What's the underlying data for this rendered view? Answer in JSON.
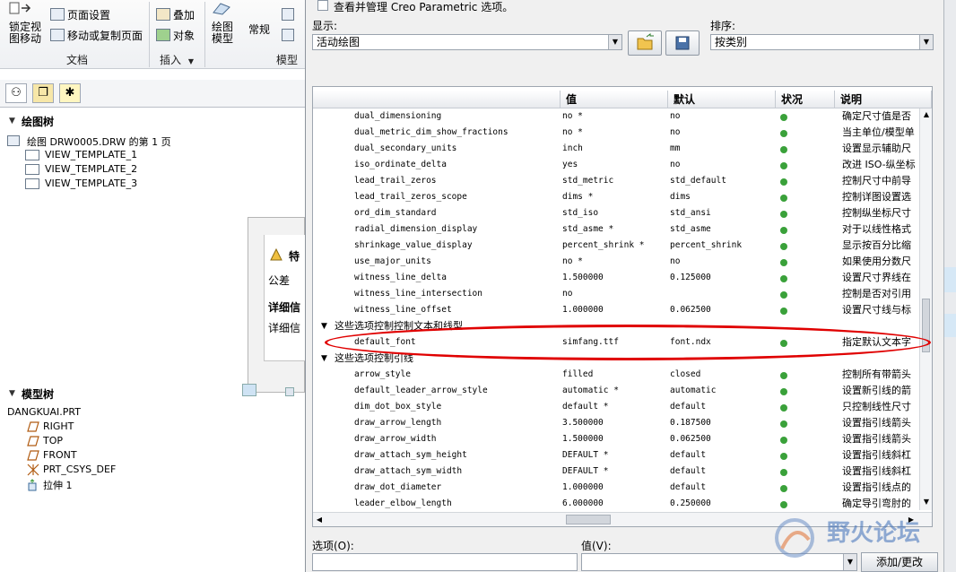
{
  "ribbon": {
    "lock_view_line1": "锁定视",
    "lock_view_line2": "图移动",
    "page_setup": "页面设置",
    "move_copy_page": "移动或复制页面",
    "overlay": "叠加",
    "object": "对象",
    "drawing_model_line1": "绘图",
    "drawing_model_line2": "模型",
    "general": "常规",
    "group_document": "文档",
    "group_insert": "插入",
    "group_insert_arrow": "▼",
    "group_model": "模型"
  },
  "left_panel": {
    "drawing_tree_title": "绘图树",
    "drawing_root": "绘图 DRW0005.DRW 的第 1 页",
    "drawing_items": [
      "VIEW_TEMPLATE_1",
      "VIEW_TEMPLATE_2",
      "VIEW_TEMPLATE_3"
    ],
    "model_tree_title": "模型树",
    "model_root": "DANGKUAI.PRT",
    "model_items": [
      "RIGHT",
      "TOP",
      "FRONT",
      "PRT_CSYS_DEF",
      "拉伸 1"
    ]
  },
  "bg_dialog": {
    "title_frag": "特",
    "tolerance": "公差",
    "detail_info": "详细信",
    "detail_info2": "详细信"
  },
  "dialog": {
    "title": "查看并管理 Creo Parametric 选项。",
    "show_label": "显示:",
    "show_value": "活动绘图",
    "sort_label": "排序:",
    "sort_value": "按类别",
    "columns": {
      "value": "值",
      "default": "默认",
      "status": "状况",
      "description": "说明"
    },
    "rows1": [
      {
        "name": "dual_dimensioning",
        "value": "no *",
        "default": "no",
        "desc": "确定尺寸值是否"
      },
      {
        "name": "dual_metric_dim_show_fractions",
        "value": "no *",
        "default": "no",
        "desc": "当主单位/模型单"
      },
      {
        "name": "dual_secondary_units",
        "value": "inch",
        "default": "mm",
        "desc": "设置显示辅助尺"
      },
      {
        "name": "iso_ordinate_delta",
        "value": "yes",
        "default": "no",
        "desc": "改进 ISO-纵坐标"
      },
      {
        "name": "lead_trail_zeros",
        "value": "std_metric",
        "default": "std_default",
        "desc": "控制尺寸中前导"
      },
      {
        "name": "lead_trail_zeros_scope",
        "value": "dims *",
        "default": "dims",
        "desc": "控制详图设置选"
      },
      {
        "name": "ord_dim_standard",
        "value": "std_iso",
        "default": "std_ansi",
        "desc": "控制纵坐标尺寸"
      },
      {
        "name": "radial_dimension_display",
        "value": "std_asme *",
        "default": "std_asme",
        "desc": "对于以线性格式"
      },
      {
        "name": "shrinkage_value_display",
        "value": "percent_shrink *",
        "default": "percent_shrink",
        "desc": "显示按百分比缩"
      },
      {
        "name": "use_major_units",
        "value": "no *",
        "default": "no",
        "desc": "如果使用分数尺"
      },
      {
        "name": "witness_line_delta",
        "value": "1.500000",
        "default": "0.125000",
        "desc": "设置尺寸界线在"
      },
      {
        "name": "witness_line_intersection",
        "value": "no",
        "default": "",
        "desc": "控制是否对引用"
      },
      {
        "name": "witness_line_offset",
        "value": "1.000000",
        "default": "0.062500",
        "desc": "设置尺寸线与标"
      }
    ],
    "group2": "这些选项控制控制文本和线型",
    "rows2": [
      {
        "name": "default_font",
        "value": "simfang.ttf",
        "default": "font.ndx",
        "desc": "指定默认文本字"
      }
    ],
    "group3": "这些选项控制引线",
    "rows3": [
      {
        "name": "arrow_style",
        "value": "filled",
        "default": "closed",
        "desc": "控制所有带箭头"
      },
      {
        "name": "default_leader_arrow_style",
        "value": "automatic *",
        "default": "automatic",
        "desc": "设置新引线的箭"
      },
      {
        "name": "dim_dot_box_style",
        "value": "default *",
        "default": "default",
        "desc": "只控制线性尺寸"
      },
      {
        "name": "draw_arrow_length",
        "value": "3.500000",
        "default": "0.187500",
        "desc": "设置指引线箭头"
      },
      {
        "name": "draw_arrow_width",
        "value": "1.500000",
        "default": "0.062500",
        "desc": "设置指引线箭头"
      },
      {
        "name": "draw_attach_sym_height",
        "value": "DEFAULT *",
        "default": "default",
        "desc": "设置指引线斜杠"
      },
      {
        "name": "draw_attach_sym_width",
        "value": "DEFAULT *",
        "default": "default",
        "desc": "设置指引线斜杠"
      },
      {
        "name": "draw_dot_diameter",
        "value": "1.000000",
        "default": "default",
        "desc": "设置指引线点的"
      },
      {
        "name": "leader_elbow_length",
        "value": "6.000000",
        "default": "0.250000",
        "desc": "确定导引弯肘的"
      }
    ],
    "option_label": "选项(O):",
    "value_label": "值(V):",
    "add_change": "添加/更改"
  },
  "watermark": {
    "text": "野火论坛"
  },
  "colors": {
    "status_green": "#3aa13a",
    "highlight_oval": "#e00000"
  }
}
